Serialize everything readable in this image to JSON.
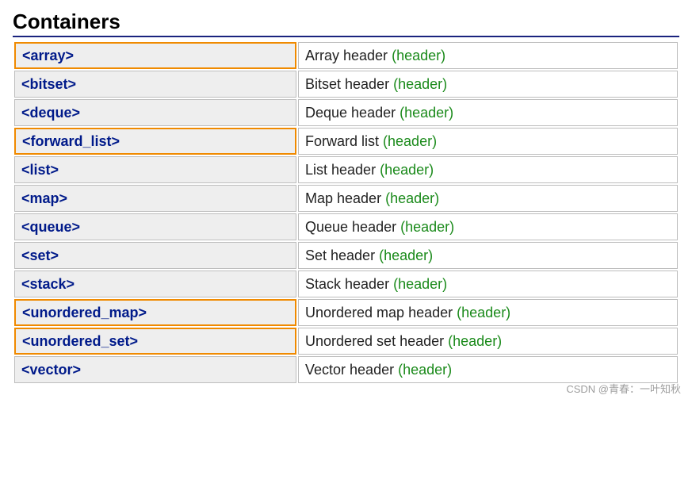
{
  "title": "Containers",
  "header_suffix": "(header)",
  "rows": [
    {
      "name": "<array>",
      "desc": "Array header",
      "highlight": true
    },
    {
      "name": "<bitset>",
      "desc": "Bitset header",
      "highlight": false
    },
    {
      "name": "<deque>",
      "desc": "Deque header",
      "highlight": false
    },
    {
      "name": "<forward_list>",
      "desc": "Forward list",
      "highlight": true
    },
    {
      "name": "<list>",
      "desc": "List header",
      "highlight": false
    },
    {
      "name": "<map>",
      "desc": "Map header",
      "highlight": false
    },
    {
      "name": "<queue>",
      "desc": "Queue header",
      "highlight": false
    },
    {
      "name": "<set>",
      "desc": "Set header",
      "highlight": false
    },
    {
      "name": "<stack>",
      "desc": "Stack header",
      "highlight": false
    },
    {
      "name": "<unordered_map>",
      "desc": "Unordered map header",
      "highlight": true
    },
    {
      "name": "<unordered_set>",
      "desc": "Unordered set header",
      "highlight": true
    },
    {
      "name": "<vector>",
      "desc": "Vector header",
      "highlight": false
    }
  ],
  "watermark": "CSDN @青春：一叶知秋"
}
